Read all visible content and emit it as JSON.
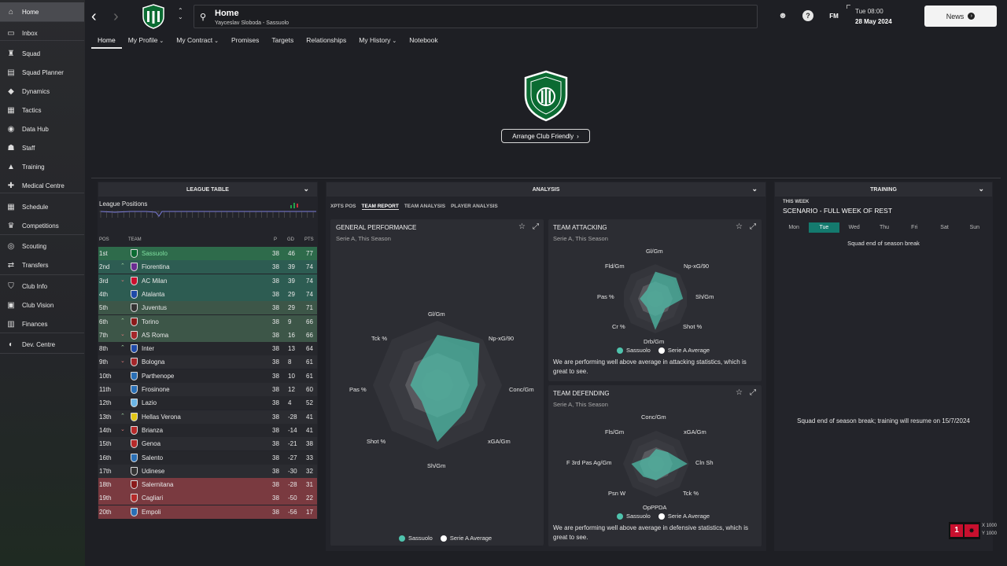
{
  "sidebar": {
    "items": [
      {
        "label": "Home",
        "icon": "home-icon"
      },
      {
        "label": "Inbox",
        "icon": "inbox-icon"
      },
      {
        "label": "Squad",
        "icon": "shirt-icon"
      },
      {
        "label": "Squad Planner",
        "icon": "planner-icon"
      },
      {
        "label": "Dynamics",
        "icon": "dynamics-icon"
      },
      {
        "label": "Tactics",
        "icon": "tactics-icon"
      },
      {
        "label": "Data Hub",
        "icon": "data-hub-icon"
      },
      {
        "label": "Staff",
        "icon": "staff-icon"
      },
      {
        "label": "Training",
        "icon": "training-icon"
      },
      {
        "label": "Medical Centre",
        "icon": "medical-icon"
      },
      {
        "label": "Schedule",
        "icon": "calendar-icon"
      },
      {
        "label": "Competitions",
        "icon": "trophy-icon"
      },
      {
        "label": "Scouting",
        "icon": "scouting-icon"
      },
      {
        "label": "Transfers",
        "icon": "transfers-icon"
      },
      {
        "label": "Club Info",
        "icon": "shield-icon"
      },
      {
        "label": "Club Vision",
        "icon": "vision-icon"
      },
      {
        "label": "Finances",
        "icon": "finances-icon"
      },
      {
        "label": "Dev. Centre",
        "icon": "dev-centre-icon"
      }
    ]
  },
  "header": {
    "title": "Home",
    "subtitle": "Yayceslav Sloboda - Sassuolo",
    "time": "Tue 08:00",
    "date": "28 May 2024",
    "news_label": "News",
    "fm_label": "FM"
  },
  "tabs": [
    "Home",
    "My Profile",
    "My Contract",
    "Promises",
    "Targets",
    "Relationships",
    "My History",
    "Notebook"
  ],
  "friendly_button": "Arrange Club Friendly",
  "league_table": {
    "title": "LEAGUE TABLE",
    "positions_label": "League Positions",
    "headers": {
      "pos": "POS",
      "team": "TEAM",
      "p": "P",
      "gd": "GD",
      "pts": "PTS"
    },
    "rows": [
      {
        "pos": "1st",
        "team": "Sassuolo",
        "p": "38",
        "gd": "46",
        "pts": "77",
        "move": ""
      },
      {
        "pos": "2nd",
        "team": "Fiorentina",
        "p": "38",
        "gd": "39",
        "pts": "74",
        "move": "up"
      },
      {
        "pos": "3rd",
        "team": "AC Milan",
        "p": "38",
        "gd": "39",
        "pts": "74",
        "move": "down"
      },
      {
        "pos": "4th",
        "team": "Atalanta",
        "p": "38",
        "gd": "29",
        "pts": "74",
        "move": ""
      },
      {
        "pos": "5th",
        "team": "Juventus",
        "p": "38",
        "gd": "29",
        "pts": "71",
        "move": ""
      },
      {
        "pos": "6th",
        "team": "Torino",
        "p": "38",
        "gd": "9",
        "pts": "66",
        "move": "up"
      },
      {
        "pos": "7th",
        "team": "AS Roma",
        "p": "38",
        "gd": "16",
        "pts": "66",
        "move": "down"
      },
      {
        "pos": "8th",
        "team": "Inter",
        "p": "38",
        "gd": "13",
        "pts": "64",
        "move": "up"
      },
      {
        "pos": "9th",
        "team": "Bologna",
        "p": "38",
        "gd": "8",
        "pts": "61",
        "move": "down"
      },
      {
        "pos": "10th",
        "team": "Parthenope",
        "p": "38",
        "gd": "10",
        "pts": "61",
        "move": ""
      },
      {
        "pos": "11th",
        "team": "Frosinone",
        "p": "38",
        "gd": "12",
        "pts": "60",
        "move": ""
      },
      {
        "pos": "12th",
        "team": "Lazio",
        "p": "38",
        "gd": "4",
        "pts": "52",
        "move": ""
      },
      {
        "pos": "13th",
        "team": "Hellas Verona",
        "p": "38",
        "gd": "-28",
        "pts": "41",
        "move": "up"
      },
      {
        "pos": "14th",
        "team": "Brianza",
        "p": "38",
        "gd": "-14",
        "pts": "41",
        "move": "down"
      },
      {
        "pos": "15th",
        "team": "Genoa",
        "p": "38",
        "gd": "-21",
        "pts": "38",
        "move": ""
      },
      {
        "pos": "16th",
        "team": "Salento",
        "p": "38",
        "gd": "-27",
        "pts": "33",
        "move": ""
      },
      {
        "pos": "17th",
        "team": "Udinese",
        "p": "38",
        "gd": "-30",
        "pts": "32",
        "move": ""
      },
      {
        "pos": "18th",
        "team": "Salernitana",
        "p": "38",
        "gd": "-28",
        "pts": "31",
        "move": ""
      },
      {
        "pos": "19th",
        "team": "Cagliari",
        "p": "38",
        "gd": "-50",
        "pts": "22",
        "move": ""
      },
      {
        "pos": "20th",
        "team": "Empoli",
        "p": "38",
        "gd": "-56",
        "pts": "17",
        "move": ""
      }
    ]
  },
  "analysis": {
    "title": "ANALYSIS",
    "subtabs": [
      "XPTS POS",
      "TEAM REPORT",
      "TEAM ANALYSIS",
      "PLAYER ANALYSIS"
    ],
    "general": {
      "title": "GENERAL PERFORMANCE",
      "subtitle": "Serie A, This Season",
      "axes": [
        "Gl/Gm",
        "Np-xG/90",
        "Conc/Gm",
        "xGA/Gm",
        "Sh/Gm",
        "Shot %",
        "Pas %",
        "Tck %"
      ],
      "team_values": [
        0.78,
        0.92,
        0.62,
        0.6,
        0.88,
        0.35,
        0.42,
        0.42
      ],
      "avg_values": [
        0.5,
        0.5,
        0.5,
        0.5,
        0.5,
        0.5,
        0.5,
        0.5
      ]
    },
    "attacking": {
      "title": "TEAM ATTACKING",
      "subtitle": "Serie A, This Season",
      "axes": [
        "Gl/Gm",
        "Np-xG/90",
        "Sh/Gm",
        "Shot %",
        "Drb/Gm",
        "Cr %",
        "Pas %",
        "Fld/Gm"
      ],
      "team_values": [
        0.78,
        0.85,
        0.8,
        0.4,
        0.9,
        0.35,
        0.45,
        0.35
      ],
      "avg_values": [
        0.5,
        0.5,
        0.5,
        0.5,
        0.5,
        0.5,
        0.5,
        0.5
      ],
      "message": "We are performing well above average in attacking statistics, which is great to see."
    },
    "defending": {
      "title": "TEAM DEFENDING",
      "subtitle": "Serie A, This Season",
      "axes": [
        "Conc/Gm",
        "xGA/Gm",
        "Cln Sh",
        "Tck %",
        "OpPPDA",
        "Psn W",
        "F 3rd Pas Ag/Gm",
        "Fls/Gm"
      ],
      "team_values": [
        0.45,
        0.5,
        0.95,
        0.45,
        0.5,
        0.55,
        0.75,
        0.3
      ],
      "avg_values": [
        0.5,
        0.5,
        0.5,
        0.5,
        0.5,
        0.5,
        0.5,
        0.5
      ],
      "message": "We are performing well above average in defensive statistics, which is great to see."
    },
    "legend_team": "Sassuolo",
    "legend_avg": "Serie A Average",
    "colors": {
      "team": "#4fc3ad",
      "avg": "#ffffff"
    }
  },
  "training": {
    "title": "TRAINING",
    "week_label": "THIS WEEK",
    "scenario": "SCENARIO - FULL WEEK OF REST",
    "days": [
      "Mon",
      "Tue",
      "Wed",
      "Thu",
      "Fri",
      "Sat",
      "Sun"
    ],
    "active_day": "Tue",
    "break_label": "Squad end of season break",
    "message": "Squad end of season break; training will resume on 15/7/2024"
  },
  "coords": {
    "x": "X 1000",
    "y": "Y 1000"
  }
}
